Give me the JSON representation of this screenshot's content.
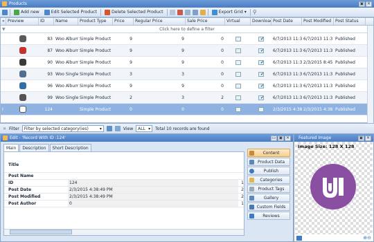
{
  "window": {
    "title": "Products"
  },
  "toolbar": {
    "add_new": "Add new",
    "edit_selected": "Edit Selected Product",
    "delete_selected": "Delete Selected Product",
    "export_grid": "Export Grid ▾"
  },
  "grid": {
    "columns": [
      "Preview",
      "ID",
      "Name",
      "Product Type",
      "Price",
      "Regular Price",
      "Sale Price",
      "Virtual",
      "Downloac",
      "Post Date",
      "Post Modified",
      "Post Status"
    ],
    "filter_hint": "Click here to define a filter",
    "rows": [
      {
        "id": "83",
        "name": "Woo Album",
        "type": "Simple Product",
        "price": "9",
        "regular": "9",
        "sale": "0",
        "virtual": false,
        "download": true,
        "date": "6/7/2013 11:3",
        "modified": "6/7/2013 11:3",
        "status": "Published",
        "thumb": "#5a5a5a"
      },
      {
        "id": "87",
        "name": "Woo Album",
        "type": "Simple Product",
        "price": "9",
        "regular": "9",
        "sale": "0",
        "virtual": false,
        "download": true,
        "date": "6/7/2013 11:3",
        "modified": "6/7/2013 11:3",
        "status": "Published",
        "thumb": "#c4332f"
      },
      {
        "id": "90",
        "name": "Woo Album",
        "type": "Simple Product",
        "price": "9",
        "regular": "9",
        "sale": "0",
        "virtual": false,
        "download": true,
        "date": "6/7/2013 11:3",
        "modified": "2/3/2015 8:45",
        "status": "Published",
        "thumb": "#3a3a3a"
      },
      {
        "id": "93",
        "name": "Woo Single",
        "type": "Simple Product",
        "price": "3",
        "regular": "3",
        "sale": "0",
        "virtual": false,
        "download": true,
        "date": "6/7/2013 11:3",
        "modified": "6/7/2013 11:3",
        "status": "Published",
        "thumb": "#4f6f8f"
      },
      {
        "id": "96",
        "name": "Woo Album",
        "type": "Simple Product",
        "price": "9",
        "regular": "9",
        "sale": "0",
        "virtual": false,
        "download": true,
        "date": "6/7/2013 11:3",
        "modified": "6/7/2013 11:3",
        "status": "Published",
        "thumb": "#2f6fa8"
      },
      {
        "id": "99",
        "name": "Woo Single",
        "type": "Simple Product",
        "price": "2",
        "regular": "3",
        "sale": "2",
        "virtual": false,
        "download": true,
        "date": "6/7/2013 11:3",
        "modified": "6/7/2013 11:3",
        "status": "Published",
        "thumb": "#555"
      },
      {
        "id": "124",
        "name": "",
        "type": "Simple Product",
        "price": "0",
        "regular": "0",
        "sale": "0",
        "virtual": false,
        "download": false,
        "date": "2/3/2015 4:38",
        "modified": "2/3/2015 4:38",
        "status": "Published",
        "thumb": "#ffffff"
      }
    ]
  },
  "filterbar": {
    "filter_label": "Filter",
    "filter_value": "Filter by selected category(ies)",
    "view_label": "View",
    "view_value": "ALL",
    "total": "Total 10 records are found"
  },
  "edit": {
    "title": "Edit - 'Record With ID :124'",
    "tabs": [
      "Main",
      "Description",
      "Short Description"
    ],
    "fields": [
      {
        "k": "Title",
        "v": "",
        "n": ""
      },
      {
        "k": "Post Name",
        "v": "",
        "n": ""
      },
      {
        "k": "ID",
        "v": "124",
        "n": "1"
      },
      {
        "k": "Post Date",
        "v": "2/3/2015 4:38:49 PM",
        "n": "2"
      },
      {
        "k": "Post Modified",
        "v": "2/3/2015 4:38:49 PM",
        "n": "2"
      },
      {
        "k": "Post Author",
        "v": "0",
        "n": "1"
      }
    ],
    "side_buttons": [
      "Content",
      "Product Data",
      "Publish",
      "Categories",
      "Product Tags",
      "Gallery",
      "Custom Fields",
      "Reviews"
    ]
  },
  "featured": {
    "title": "Featured Image",
    "size": "Image Size: 128 X 128",
    "logo_color": "#8a4fa3"
  }
}
